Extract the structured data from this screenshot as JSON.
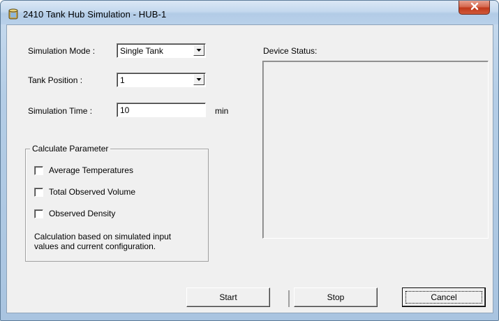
{
  "window": {
    "title": "2410 Tank Hub Simulation - HUB-1"
  },
  "form": {
    "simulation_mode_label": "Simulation Mode :",
    "simulation_mode_value": "Single Tank",
    "tank_position_label": "Tank Position :",
    "tank_position_value": "1",
    "simulation_time_label": "Simulation Time :",
    "simulation_time_value": "10",
    "simulation_time_unit": "min"
  },
  "calculate_group": {
    "title": "Calculate Parameter",
    "options": [
      {
        "label": "Average Temperatures",
        "checked": false
      },
      {
        "label": "Total Observed Volume",
        "checked": false
      },
      {
        "label": "Observed Density",
        "checked": false
      }
    ],
    "note_line1": "Calculation based on simulated input",
    "note_line2": "values and current configuration."
  },
  "device_status": {
    "label": "Device Status:"
  },
  "buttons": {
    "start": "Start",
    "stop": "Stop",
    "cancel": "Cancel"
  },
  "icons": {
    "app": "tank-icon",
    "close": "close-icon",
    "dropdown": "chevron-down-icon"
  },
  "colors": {
    "close_button": "#c0391b",
    "dialog_bg": "#f0f0f0"
  }
}
